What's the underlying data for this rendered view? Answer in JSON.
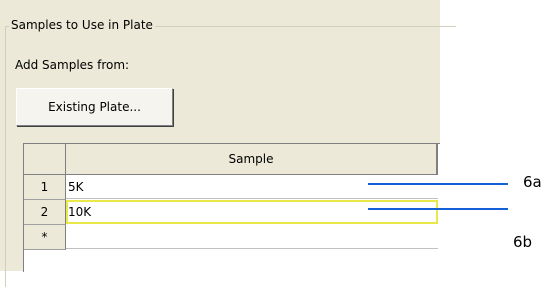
{
  "group": {
    "title": "Samples to Use in Plate"
  },
  "add_samples": {
    "label": "Add Samples from:",
    "button_label": "Existing Plate..."
  },
  "grid": {
    "column_header": "Sample",
    "rows": [
      {
        "row_header": "1",
        "sample": "5K"
      },
      {
        "row_header": "2",
        "sample": "10K"
      },
      {
        "row_header": "*",
        "sample": ""
      }
    ]
  },
  "callouts": [
    "6a",
    "6b"
  ]
}
